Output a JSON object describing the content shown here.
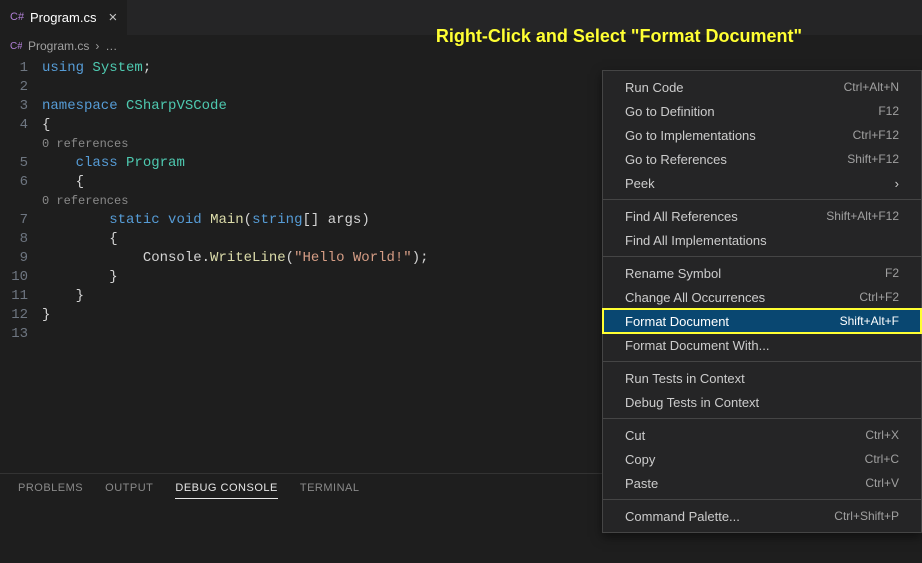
{
  "tab": {
    "filename": "Program.cs",
    "close": "×"
  },
  "breadcrumb": {
    "file": "Program.cs",
    "sep": "›",
    "dots": "…"
  },
  "annotation": "Right-Click and Select \"Format Document\"",
  "gutter": [
    "1",
    "2",
    "3",
    "4",
    "5",
    "6",
    "7",
    "8",
    "9",
    "10",
    "11",
    "12",
    "13"
  ],
  "code": {
    "l1": {
      "kw1": "using",
      "ns": "System",
      "p": ";"
    },
    "l3": {
      "kw": "namespace",
      "name": "CSharpVSCode"
    },
    "l4": {
      "brace": "{"
    },
    "ref1": "0 references",
    "l5": {
      "kw": "class",
      "name": "Program"
    },
    "l6": {
      "brace": "{"
    },
    "ref2": "0 references",
    "l7": {
      "kw1": "static",
      "kw2": "void",
      "fn": "Main",
      "p1": "(",
      "kw3": "string",
      "p2": "[] ",
      "arg": "args",
      "p3": ")"
    },
    "l8": {
      "brace": "{"
    },
    "l9": {
      "obj": "Console",
      "dot": ".",
      "fn": "WriteLine",
      "p1": "(",
      "str": "\"Hello World!\"",
      "p2": ");"
    },
    "l10": {
      "brace": "}"
    },
    "l11": {
      "brace": "}"
    },
    "l12": {
      "brace": "}"
    }
  },
  "panel": {
    "tabs": [
      "PROBLEMS",
      "OUTPUT",
      "DEBUG CONSOLE",
      "TERMINAL"
    ],
    "active": 2
  },
  "menu": {
    "items": [
      {
        "label": "Run Code",
        "shortcut": "Ctrl+Alt+N"
      },
      {
        "label": "Go to Definition",
        "shortcut": "F12"
      },
      {
        "label": "Go to Implementations",
        "shortcut": "Ctrl+F12"
      },
      {
        "label": "Go to References",
        "shortcut": "Shift+F12"
      },
      {
        "label": "Peek",
        "submenu": true
      },
      {
        "sep": true
      },
      {
        "label": "Find All References",
        "shortcut": "Shift+Alt+F12"
      },
      {
        "label": "Find All Implementations"
      },
      {
        "sep": true
      },
      {
        "label": "Rename Symbol",
        "shortcut": "F2"
      },
      {
        "label": "Change All Occurrences",
        "shortcut": "Ctrl+F2"
      },
      {
        "label": "Format Document",
        "shortcut": "Shift+Alt+F",
        "selected": true,
        "highlight": true
      },
      {
        "label": "Format Document With..."
      },
      {
        "sep": true
      },
      {
        "label": "Run Tests in Context"
      },
      {
        "label": "Debug Tests in Context"
      },
      {
        "sep": true
      },
      {
        "label": "Cut",
        "shortcut": "Ctrl+X"
      },
      {
        "label": "Copy",
        "shortcut": "Ctrl+C"
      },
      {
        "label": "Paste",
        "shortcut": "Ctrl+V"
      },
      {
        "sep": true
      },
      {
        "label": "Command Palette...",
        "shortcut": "Ctrl+Shift+P"
      }
    ]
  }
}
